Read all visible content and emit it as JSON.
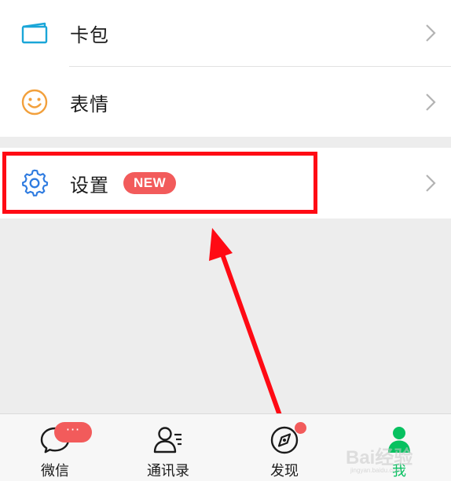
{
  "list": {
    "items": [
      {
        "label": "卡包",
        "icon": "card-pack-icon",
        "icon_color": "#1aa6d8"
      },
      {
        "label": "表情",
        "icon": "emoji-icon",
        "icon_color": "#f2a03c"
      },
      {
        "label": "设置",
        "icon": "gear-icon",
        "icon_color": "#2e7be0",
        "badge": "NEW"
      }
    ]
  },
  "tabbar": {
    "tabs": [
      {
        "label": "微信",
        "icon": "chat-icon",
        "badge": "···"
      },
      {
        "label": "通讯录",
        "icon": "contacts-icon"
      },
      {
        "label": "发现",
        "icon": "compass-icon"
      },
      {
        "label": "我",
        "icon": "me-icon",
        "active": true
      }
    ]
  },
  "annotation": {
    "color": "#ff0a14"
  },
  "watermark": {
    "text": "Bai经验",
    "sub": "jingyan.baidu.com"
  },
  "colors": {
    "accent_green": "#07c160",
    "badge_red": "#f25b5b",
    "background": "#ededed"
  }
}
